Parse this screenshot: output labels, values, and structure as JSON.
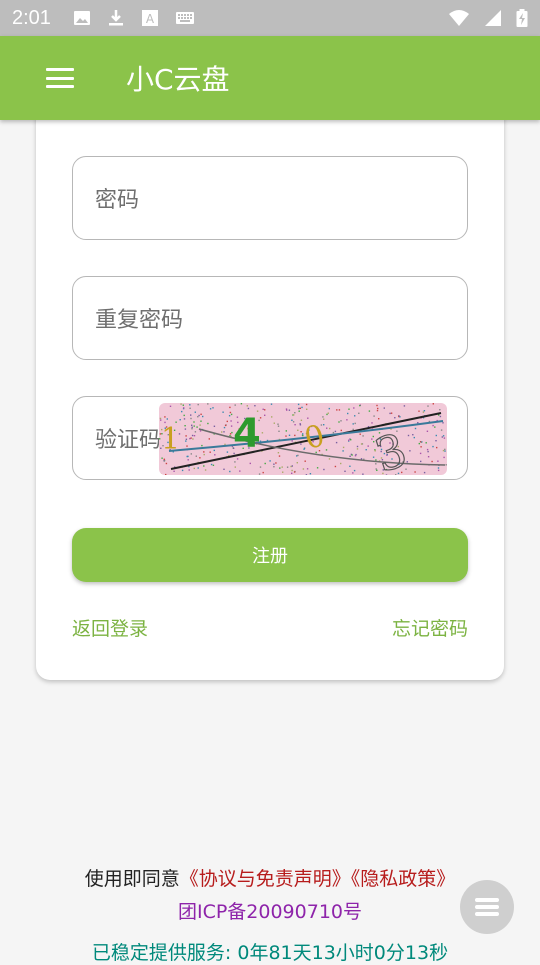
{
  "status_bar": {
    "time": "2:01",
    "icons_left": [
      "image-icon",
      "download-icon",
      "font-icon",
      "keyboard-icon"
    ],
    "icons_right": [
      "wifi-icon",
      "signal-icon",
      "battery-icon"
    ]
  },
  "app_bar": {
    "title": "小C云盘",
    "menu_icon": "menu-icon",
    "color": "#8bc34a"
  },
  "form": {
    "password_placeholder": "密码",
    "repeat_password_placeholder": "重复密码",
    "captcha_placeholder": "验证码",
    "captcha_chars": [
      "1",
      "4",
      "0",
      "3"
    ],
    "submit_label": "注册",
    "back_to_login": "返回登录",
    "forgot_password": "忘记密码"
  },
  "footer": {
    "agree_prefix": "使用即同意",
    "agreement_link": "《协议与免责声明》",
    "privacy_link": "《隐私政策》",
    "icp": "团ICP备20090710号",
    "uptime": "已稳定提供服务: 0年81天13小时0分13秒"
  },
  "fab": {
    "icon": "menu-icon"
  }
}
